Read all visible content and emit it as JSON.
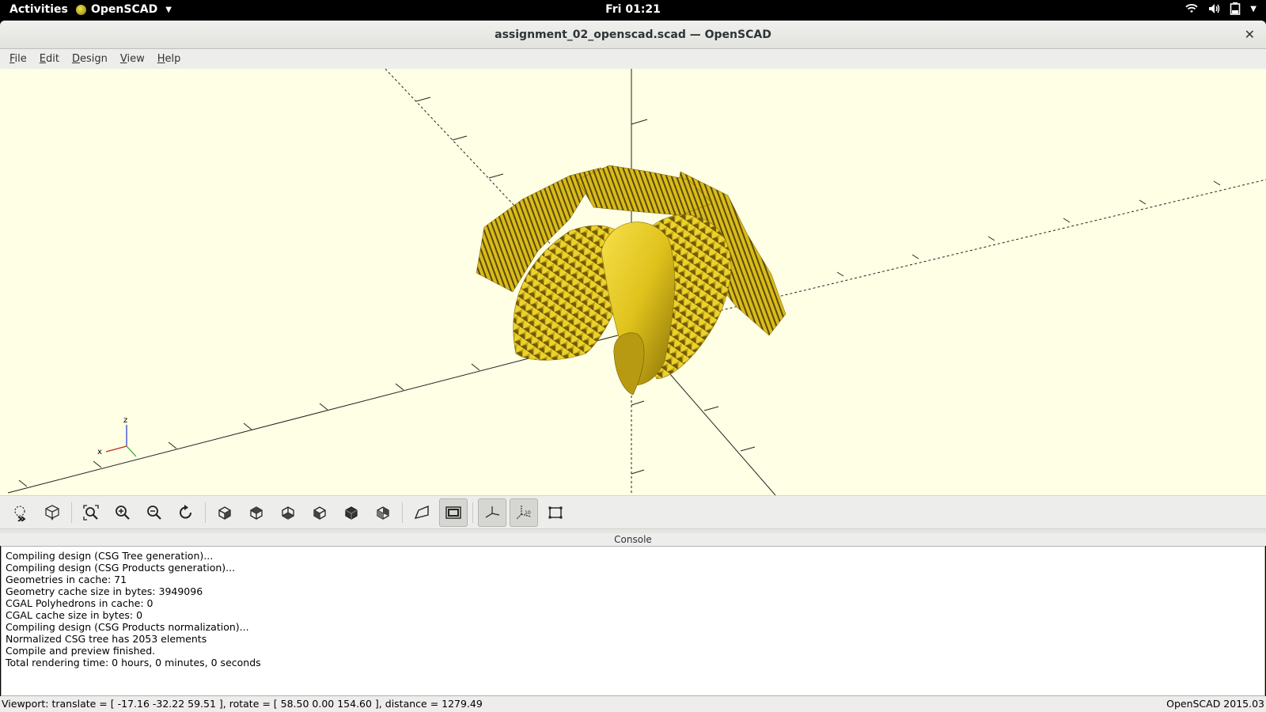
{
  "topbar": {
    "activities": "Activities",
    "app_name": "OpenSCAD",
    "clock": "Fri 01:21",
    "tray_icons": [
      "wifi-icon",
      "volume-icon",
      "battery-icon",
      "menu-caret-icon"
    ]
  },
  "window": {
    "title": "assignment_02_openscad.scad — OpenSCAD",
    "close_label": "✕"
  },
  "menubar": {
    "items": [
      "File",
      "Edit",
      "Design",
      "View",
      "Help"
    ]
  },
  "viewport": {
    "background_color": "#ffffe5",
    "model_color": "#f0d020",
    "axis_labels": {
      "x": "x",
      "z": "z"
    }
  },
  "toolbar": {
    "buttons": [
      {
        "name": "preview-icon",
        "active": false
      },
      {
        "name": "render-icon",
        "active": false
      },
      {
        "name": "view-all-icon",
        "active": false
      },
      {
        "name": "zoom-in-icon",
        "active": false
      },
      {
        "name": "zoom-out-icon",
        "active": false
      },
      {
        "name": "reset-view-icon",
        "active": false
      },
      {
        "name": "view-right-icon",
        "active": false
      },
      {
        "name": "view-top-icon",
        "active": false
      },
      {
        "name": "view-bottom-icon",
        "active": false
      },
      {
        "name": "view-left-icon",
        "active": false
      },
      {
        "name": "view-front-icon",
        "active": false
      },
      {
        "name": "view-back-icon",
        "active": false
      },
      {
        "name": "perspective-icon",
        "active": false
      },
      {
        "name": "orthogonal-icon",
        "active": true
      },
      {
        "name": "show-axes-icon",
        "active": true
      },
      {
        "name": "show-scale-markers-icon",
        "active": true
      },
      {
        "name": "show-edges-icon",
        "active": false
      }
    ]
  },
  "console": {
    "header": "Console",
    "lines": [
      "Compiling design (CSG Tree generation)...",
      "Compiling design (CSG Products generation)...",
      "Geometries in cache: 71",
      "Geometry cache size in bytes: 3949096",
      "CGAL Polyhedrons in cache: 0",
      "CGAL cache size in bytes: 0",
      "Compiling design (CSG Products normalization)...",
      "Normalized CSG tree has 2053 elements",
      "Compile and preview finished.",
      "Total rendering time: 0 hours, 0 minutes, 0 seconds"
    ]
  },
  "statusbar": {
    "viewport_info": "Viewport: translate = [ -17.16 -32.22 59.51 ], rotate = [ 58.50 0.00 154.60 ], distance = 1279.49",
    "version": "OpenSCAD 2015.03"
  }
}
